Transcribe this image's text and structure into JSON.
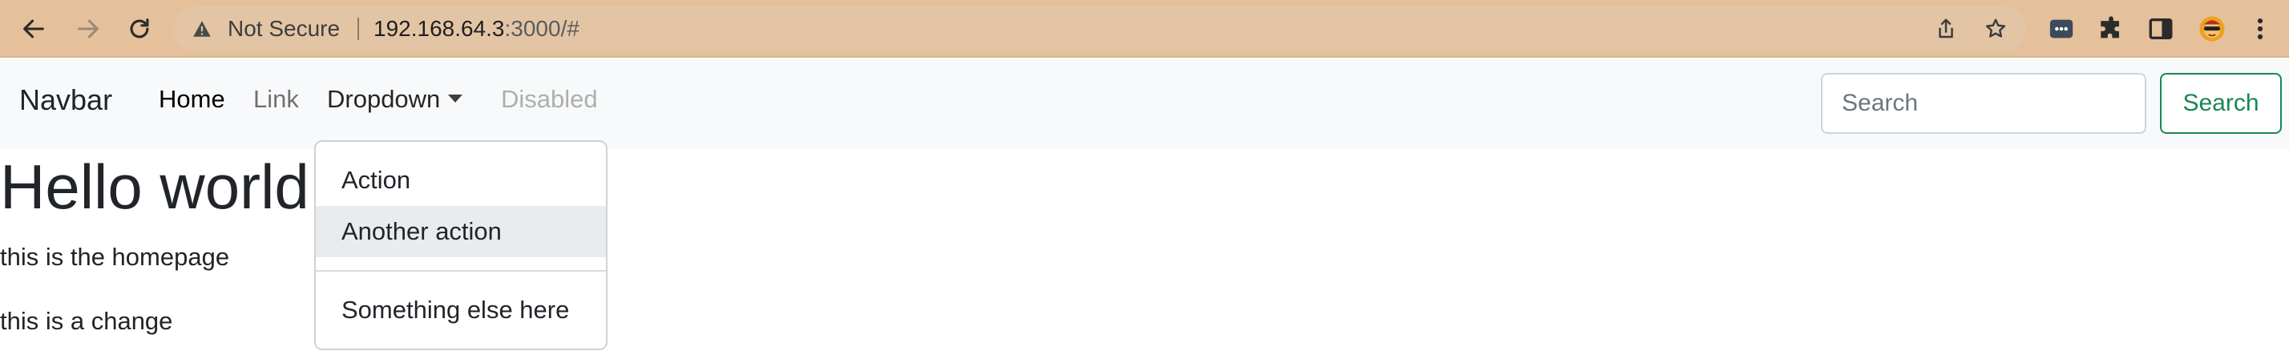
{
  "browser": {
    "security_label": "Not Secure",
    "url_host": "192.168.64.3",
    "url_rest": ":3000/#"
  },
  "navbar": {
    "brand": "Navbar",
    "links": [
      {
        "label": "Home",
        "state": "active"
      },
      {
        "label": "Link",
        "state": "normal"
      },
      {
        "label": "Dropdown",
        "state": "open"
      },
      {
        "label": "Disabled",
        "state": "disabled"
      }
    ],
    "search_placeholder": "Search",
    "search_button": "Search"
  },
  "dropdown": {
    "items": [
      {
        "label": "Action"
      },
      {
        "label": "Another action",
        "highlighted": true
      },
      {
        "label": "Something else here"
      }
    ]
  },
  "content": {
    "heading": "Hello world",
    "paragraphs": [
      "this is the homepage",
      "this is a change"
    ]
  },
  "colors": {
    "chrome_bg": "#e5c19b",
    "navbar_bg": "#f8f9fa",
    "success": "#198754",
    "dropdown_hover": "#e9ecef"
  }
}
